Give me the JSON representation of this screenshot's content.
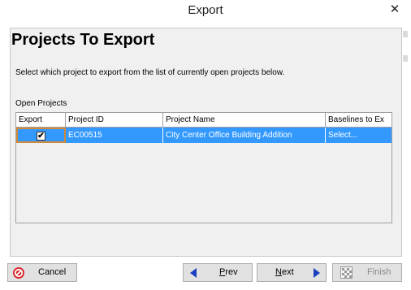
{
  "window": {
    "title": "Export",
    "close_glyph": "✕"
  },
  "page": {
    "heading": "Projects To Export",
    "instructions": "Select which project to export from the list of currently open projects below.",
    "group_label": "Open Projects"
  },
  "table": {
    "columns": [
      "Export",
      "Project ID",
      "Project Name",
      "Baselines to Ex"
    ],
    "rows": [
      {
        "export_checked": true,
        "project_id": "EC00515",
        "project_name": "City Center Office Building Addition",
        "baselines": "Select..."
      }
    ]
  },
  "buttons": {
    "cancel": "Cancel",
    "prev": {
      "accel": "P",
      "rest": "rev"
    },
    "next": {
      "accel": "N",
      "rest": "ext"
    },
    "finish": "Finish"
  },
  "icons": {
    "cancel": "cancel-icon",
    "prev": "arrow-left-icon",
    "next": "arrow-right-icon",
    "finish": "finish-flag-icon",
    "checkbox_mark": "✔"
  },
  "colors": {
    "selection": "#3399ff",
    "focus_border": "#d08a3a",
    "arrow": "#1c3fbf",
    "cancel_icon": "#d9262c"
  }
}
